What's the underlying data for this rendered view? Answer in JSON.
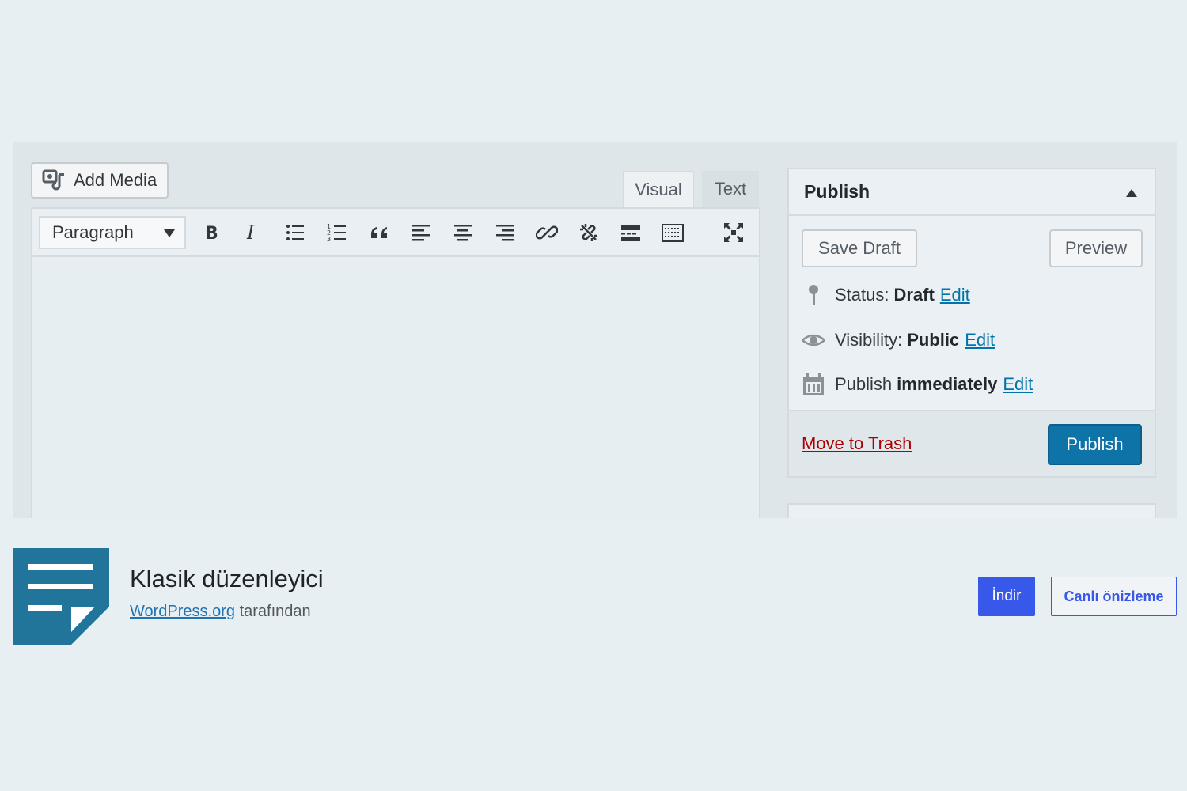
{
  "editor": {
    "add_media_label": "Add Media",
    "tabs": {
      "visual": "Visual",
      "text": "Text"
    },
    "format_select_value": "Paragraph",
    "toolbar_icons": [
      "bold-icon",
      "italic-icon",
      "bullet-list-icon",
      "numbered-list-icon",
      "blockquote-icon",
      "align-left-icon",
      "align-center-icon",
      "align-right-icon",
      "link-icon",
      "unlink-icon",
      "read-more-icon",
      "toolbar-toggle-icon",
      "fullscreen-icon"
    ]
  },
  "publish_box": {
    "title": "Publish",
    "save_draft_label": "Save Draft",
    "preview_label": "Preview",
    "status_label": "Status:",
    "status_value": "Draft",
    "visibility_label": "Visibility:",
    "visibility_value": "Public",
    "publish_label": "Publish",
    "publish_value": "immediately",
    "edit_label": "Edit",
    "trash_label": "Move to Trash",
    "publish_button_label": "Publish"
  },
  "plugin": {
    "name": "Klasik düzenleyici",
    "author_link": "WordPress.org",
    "author_suffix": "tarafından",
    "download_label": "İndir",
    "live_preview_label": "Canlı önizleme",
    "icon_color": "#21759b"
  }
}
